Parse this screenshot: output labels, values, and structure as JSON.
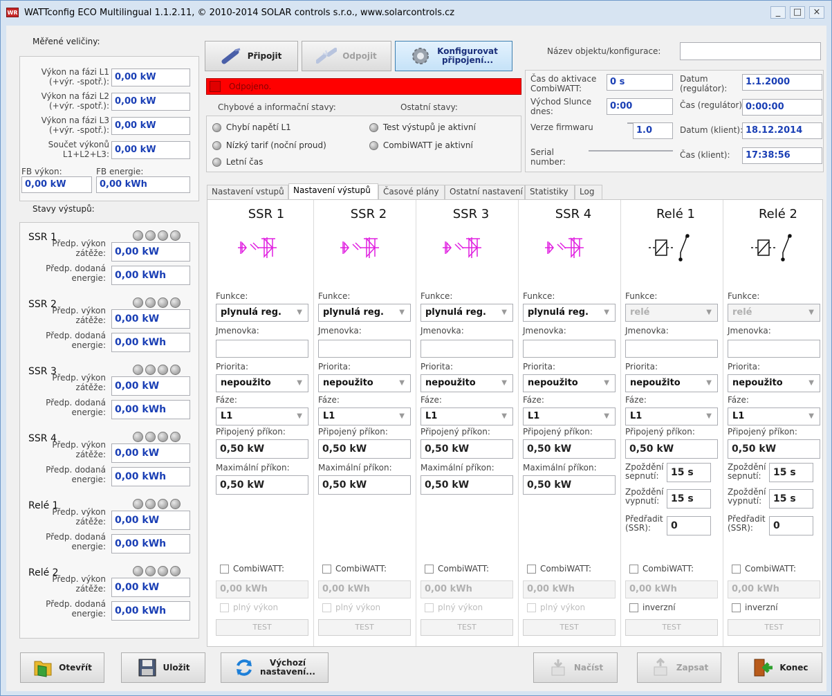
{
  "window": {
    "title": "WATTconfig ECO Multilingual 1.1.2.11, © 2010-2014 SOLAR controls s.r.o., www.solarcontrols.cz",
    "icon_text": "WR",
    "minimize": "_",
    "maximize": "□",
    "close": "×"
  },
  "measured": {
    "header": "Měřené veličiny:",
    "rows": [
      {
        "label": "Výkon na fázi L1\n(+výr. -spotř.):",
        "value": "0,00 kW"
      },
      {
        "label": "Výkon na fázi L2\n(+výr. -spotř.):",
        "value": "0,00 kW"
      },
      {
        "label": "Výkon na fázi L3\n(+výr. -spotř.):",
        "value": "0,00 kW"
      },
      {
        "label": "Součet výkonů\nL1+L2+L3:",
        "value": "0,00 kW"
      }
    ],
    "fb_power_label": "FB výkon:",
    "fb_power": "0,00 kW",
    "fb_energy_label": "FB energie:",
    "fb_energy": "0,00 kWh"
  },
  "outputs_state": {
    "header": "Stavy výstupů:",
    "load_label": "Předp. výkon\nzátěže:",
    "energy_label": "Předp. dodaná\nenergie:",
    "items": [
      {
        "name": "SSR 1",
        "power": "0,00 kW",
        "energy": "0,00 kWh"
      },
      {
        "name": "SSR 2",
        "power": "0,00 kW",
        "energy": "0,00 kWh"
      },
      {
        "name": "SSR 3",
        "power": "0,00 kW",
        "energy": "0,00 kWh"
      },
      {
        "name": "SSR 4",
        "power": "0,00 kW",
        "energy": "0,00 kWh"
      },
      {
        "name": "Relé 1",
        "power": "0,00 kW",
        "energy": "0,00 kWh"
      },
      {
        "name": "Relé 2",
        "power": "0,00 kW",
        "energy": "0,00 kWh"
      }
    ]
  },
  "connection": {
    "connect": "Připojit",
    "disconnect": "Odpojit",
    "configure": "Konfigurovat\npřipojení...",
    "status": "Odpojeno.",
    "status_color": "#ff0000"
  },
  "states": {
    "errors_header": "Chybové a informační stavy:",
    "other_header": "Ostatní stavy:",
    "errors": [
      "Chybí napětí L1",
      "Nízký tarif (noční proud)",
      "Letní čas"
    ],
    "other": [
      "Test výstupů je aktivní",
      "CombiWATT je aktivní"
    ]
  },
  "object": {
    "name_label": "Název objektu/konfigurace:",
    "name_value": "",
    "activation_label": "Čas do aktivace\nCombiWATT:",
    "activation": "0 s",
    "sunrise_label": "Východ Slunce\ndnes:",
    "sunrise": "0:00",
    "fw_label": "Verze firmwaru",
    "fw_prefix": "",
    "fw": "1.0",
    "serial_label": "Serial\nnumber:",
    "serial": "",
    "date_reg_label": "Datum\n(regulátor):",
    "date_reg": "1.1.2000",
    "time_reg_label": "Čas (regulátor):",
    "time_reg": "0:00:00",
    "date_cli_label": "Datum (klient):",
    "date_cli": "18.12.2014",
    "time_cli_label": "Čas (klient):",
    "time_cli": "17:38:56"
  },
  "tabs": [
    "Nastavení vstupů",
    "Nastavení výstupů",
    "Časové plány",
    "Ostatní nastavení",
    "Statistiky",
    "Log"
  ],
  "labels": {
    "funkce": "Funkce:",
    "jmenovka": "Jmenovka:",
    "priorita": "Priorita:",
    "faze": "Fáze:",
    "prikon": "Připojený příkon:",
    "max": "Maximální příkon:",
    "del_on": "Zpoždění\nsepnutí:",
    "del_off": "Zpoždění\nvypnutí:",
    "preradit": "Předřadit\n(SSR):",
    "combi": "CombiWATT:",
    "full": "plný výkon",
    "inverse": "inverzní",
    "test": "TEST"
  },
  "columns": [
    {
      "title": "SSR 1",
      "type": "ssr",
      "funkce": "plynulá reg.",
      "priorita": "nepoužito",
      "faze": "L1",
      "prikon": "0,50 kW",
      "max": "0,50 kW",
      "combi": "0,00 kWh"
    },
    {
      "title": "SSR 2",
      "type": "ssr",
      "funkce": "plynulá reg.",
      "priorita": "nepoužito",
      "faze": "L1",
      "prikon": "0,50 kW",
      "max": "0,50 kW",
      "combi": "0,00 kWh"
    },
    {
      "title": "SSR 3",
      "type": "ssr",
      "funkce": "plynulá reg.",
      "priorita": "nepoužito",
      "faze": "L1",
      "prikon": "0,50 kW",
      "max": "0,50 kW",
      "combi": "0,00 kWh"
    },
    {
      "title": "SSR 4",
      "type": "ssr",
      "funkce": "plynulá reg.",
      "priorita": "nepoužito",
      "faze": "L1",
      "prikon": "0,50 kW",
      "max": "0,50 kW",
      "combi": "0,00 kWh"
    },
    {
      "title": "Relé 1",
      "type": "relay",
      "funkce": "relé",
      "priorita": "nepoužito",
      "faze": "L1",
      "prikon": "0,50 kW",
      "del_on": "15 s",
      "del_off": "15 s",
      "preradit": "0",
      "combi": "0,00 kWh"
    },
    {
      "title": "Relé 2",
      "type": "relay",
      "funkce": "relé",
      "priorita": "nepoužito",
      "faze": "L1",
      "prikon": "0,50 kW",
      "del_on": "15 s",
      "del_off": "15 s",
      "preradit": "0",
      "combi": "0,00 kWh"
    }
  ],
  "bottom": {
    "open": "Otevřít",
    "save": "Uložit",
    "defaults": "Výchozí\nnastavení...",
    "load": "Načíst",
    "write": "Zapsat",
    "exit": "Konec"
  },
  "colors": {
    "accent_blue": "#1a3fb5",
    "ssr_symbol": "#e020e0",
    "status_red": "#ff0000"
  }
}
